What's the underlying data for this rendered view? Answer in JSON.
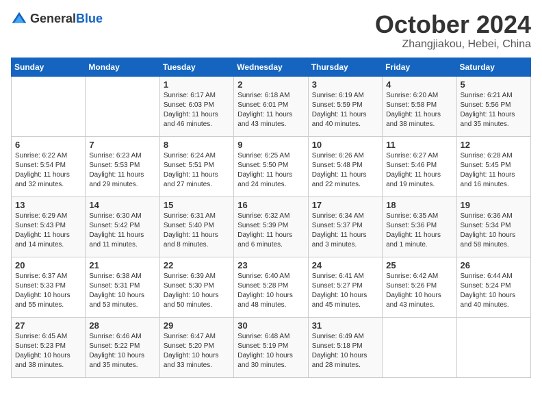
{
  "header": {
    "logo_general": "General",
    "logo_blue": "Blue",
    "month": "October 2024",
    "location": "Zhangjiakou, Hebei, China"
  },
  "weekdays": [
    "Sunday",
    "Monday",
    "Tuesday",
    "Wednesday",
    "Thursday",
    "Friday",
    "Saturday"
  ],
  "weeks": [
    [
      {
        "day": "",
        "sunrise": "",
        "sunset": "",
        "daylight": ""
      },
      {
        "day": "",
        "sunrise": "",
        "sunset": "",
        "daylight": ""
      },
      {
        "day": "1",
        "sunrise": "Sunrise: 6:17 AM",
        "sunset": "Sunset: 6:03 PM",
        "daylight": "Daylight: 11 hours and 46 minutes."
      },
      {
        "day": "2",
        "sunrise": "Sunrise: 6:18 AM",
        "sunset": "Sunset: 6:01 PM",
        "daylight": "Daylight: 11 hours and 43 minutes."
      },
      {
        "day": "3",
        "sunrise": "Sunrise: 6:19 AM",
        "sunset": "Sunset: 5:59 PM",
        "daylight": "Daylight: 11 hours and 40 minutes."
      },
      {
        "day": "4",
        "sunrise": "Sunrise: 6:20 AM",
        "sunset": "Sunset: 5:58 PM",
        "daylight": "Daylight: 11 hours and 38 minutes."
      },
      {
        "day": "5",
        "sunrise": "Sunrise: 6:21 AM",
        "sunset": "Sunset: 5:56 PM",
        "daylight": "Daylight: 11 hours and 35 minutes."
      }
    ],
    [
      {
        "day": "6",
        "sunrise": "Sunrise: 6:22 AM",
        "sunset": "Sunset: 5:54 PM",
        "daylight": "Daylight: 11 hours and 32 minutes."
      },
      {
        "day": "7",
        "sunrise": "Sunrise: 6:23 AM",
        "sunset": "Sunset: 5:53 PM",
        "daylight": "Daylight: 11 hours and 29 minutes."
      },
      {
        "day": "8",
        "sunrise": "Sunrise: 6:24 AM",
        "sunset": "Sunset: 5:51 PM",
        "daylight": "Daylight: 11 hours and 27 minutes."
      },
      {
        "day": "9",
        "sunrise": "Sunrise: 6:25 AM",
        "sunset": "Sunset: 5:50 PM",
        "daylight": "Daylight: 11 hours and 24 minutes."
      },
      {
        "day": "10",
        "sunrise": "Sunrise: 6:26 AM",
        "sunset": "Sunset: 5:48 PM",
        "daylight": "Daylight: 11 hours and 22 minutes."
      },
      {
        "day": "11",
        "sunrise": "Sunrise: 6:27 AM",
        "sunset": "Sunset: 5:46 PM",
        "daylight": "Daylight: 11 hours and 19 minutes."
      },
      {
        "day": "12",
        "sunrise": "Sunrise: 6:28 AM",
        "sunset": "Sunset: 5:45 PM",
        "daylight": "Daylight: 11 hours and 16 minutes."
      }
    ],
    [
      {
        "day": "13",
        "sunrise": "Sunrise: 6:29 AM",
        "sunset": "Sunset: 5:43 PM",
        "daylight": "Daylight: 11 hours and 14 minutes."
      },
      {
        "day": "14",
        "sunrise": "Sunrise: 6:30 AM",
        "sunset": "Sunset: 5:42 PM",
        "daylight": "Daylight: 11 hours and 11 minutes."
      },
      {
        "day": "15",
        "sunrise": "Sunrise: 6:31 AM",
        "sunset": "Sunset: 5:40 PM",
        "daylight": "Daylight: 11 hours and 8 minutes."
      },
      {
        "day": "16",
        "sunrise": "Sunrise: 6:32 AM",
        "sunset": "Sunset: 5:39 PM",
        "daylight": "Daylight: 11 hours and 6 minutes."
      },
      {
        "day": "17",
        "sunrise": "Sunrise: 6:34 AM",
        "sunset": "Sunset: 5:37 PM",
        "daylight": "Daylight: 11 hours and 3 minutes."
      },
      {
        "day": "18",
        "sunrise": "Sunrise: 6:35 AM",
        "sunset": "Sunset: 5:36 PM",
        "daylight": "Daylight: 11 hours and 1 minute."
      },
      {
        "day": "19",
        "sunrise": "Sunrise: 6:36 AM",
        "sunset": "Sunset: 5:34 PM",
        "daylight": "Daylight: 10 hours and 58 minutes."
      }
    ],
    [
      {
        "day": "20",
        "sunrise": "Sunrise: 6:37 AM",
        "sunset": "Sunset: 5:33 PM",
        "daylight": "Daylight: 10 hours and 55 minutes."
      },
      {
        "day": "21",
        "sunrise": "Sunrise: 6:38 AM",
        "sunset": "Sunset: 5:31 PM",
        "daylight": "Daylight: 10 hours and 53 minutes."
      },
      {
        "day": "22",
        "sunrise": "Sunrise: 6:39 AM",
        "sunset": "Sunset: 5:30 PM",
        "daylight": "Daylight: 10 hours and 50 minutes."
      },
      {
        "day": "23",
        "sunrise": "Sunrise: 6:40 AM",
        "sunset": "Sunset: 5:28 PM",
        "daylight": "Daylight: 10 hours and 48 minutes."
      },
      {
        "day": "24",
        "sunrise": "Sunrise: 6:41 AM",
        "sunset": "Sunset: 5:27 PM",
        "daylight": "Daylight: 10 hours and 45 minutes."
      },
      {
        "day": "25",
        "sunrise": "Sunrise: 6:42 AM",
        "sunset": "Sunset: 5:26 PM",
        "daylight": "Daylight: 10 hours and 43 minutes."
      },
      {
        "day": "26",
        "sunrise": "Sunrise: 6:44 AM",
        "sunset": "Sunset: 5:24 PM",
        "daylight": "Daylight: 10 hours and 40 minutes."
      }
    ],
    [
      {
        "day": "27",
        "sunrise": "Sunrise: 6:45 AM",
        "sunset": "Sunset: 5:23 PM",
        "daylight": "Daylight: 10 hours and 38 minutes."
      },
      {
        "day": "28",
        "sunrise": "Sunrise: 6:46 AM",
        "sunset": "Sunset: 5:22 PM",
        "daylight": "Daylight: 10 hours and 35 minutes."
      },
      {
        "day": "29",
        "sunrise": "Sunrise: 6:47 AM",
        "sunset": "Sunset: 5:20 PM",
        "daylight": "Daylight: 10 hours and 33 minutes."
      },
      {
        "day": "30",
        "sunrise": "Sunrise: 6:48 AM",
        "sunset": "Sunset: 5:19 PM",
        "daylight": "Daylight: 10 hours and 30 minutes."
      },
      {
        "day": "31",
        "sunrise": "Sunrise: 6:49 AM",
        "sunset": "Sunset: 5:18 PM",
        "daylight": "Daylight: 10 hours and 28 minutes."
      },
      {
        "day": "",
        "sunrise": "",
        "sunset": "",
        "daylight": ""
      },
      {
        "day": "",
        "sunrise": "",
        "sunset": "",
        "daylight": ""
      }
    ]
  ]
}
